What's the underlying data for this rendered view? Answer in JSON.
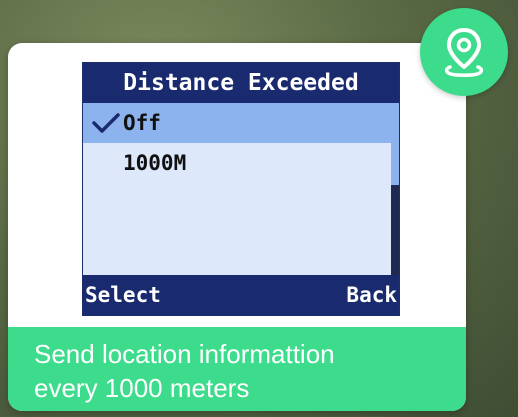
{
  "device_screen": {
    "title": "Distance Exceeded",
    "options": [
      {
        "label": "Off",
        "selected": true
      },
      {
        "label": "1000M",
        "selected": false
      }
    ],
    "softkeys": {
      "left": "Select",
      "right": "Back"
    }
  },
  "caption": {
    "line1": "Send location informattion",
    "line2": "every 1000 meters"
  },
  "icons": {
    "badge": "location-pin-icon",
    "selection": "checkmark-icon"
  },
  "colors": {
    "accent_green": "#3ddb8c",
    "screen_navy": "#1a2a6e",
    "highlight_blue": "#8db3ee",
    "screen_background": "#dde9fb"
  }
}
